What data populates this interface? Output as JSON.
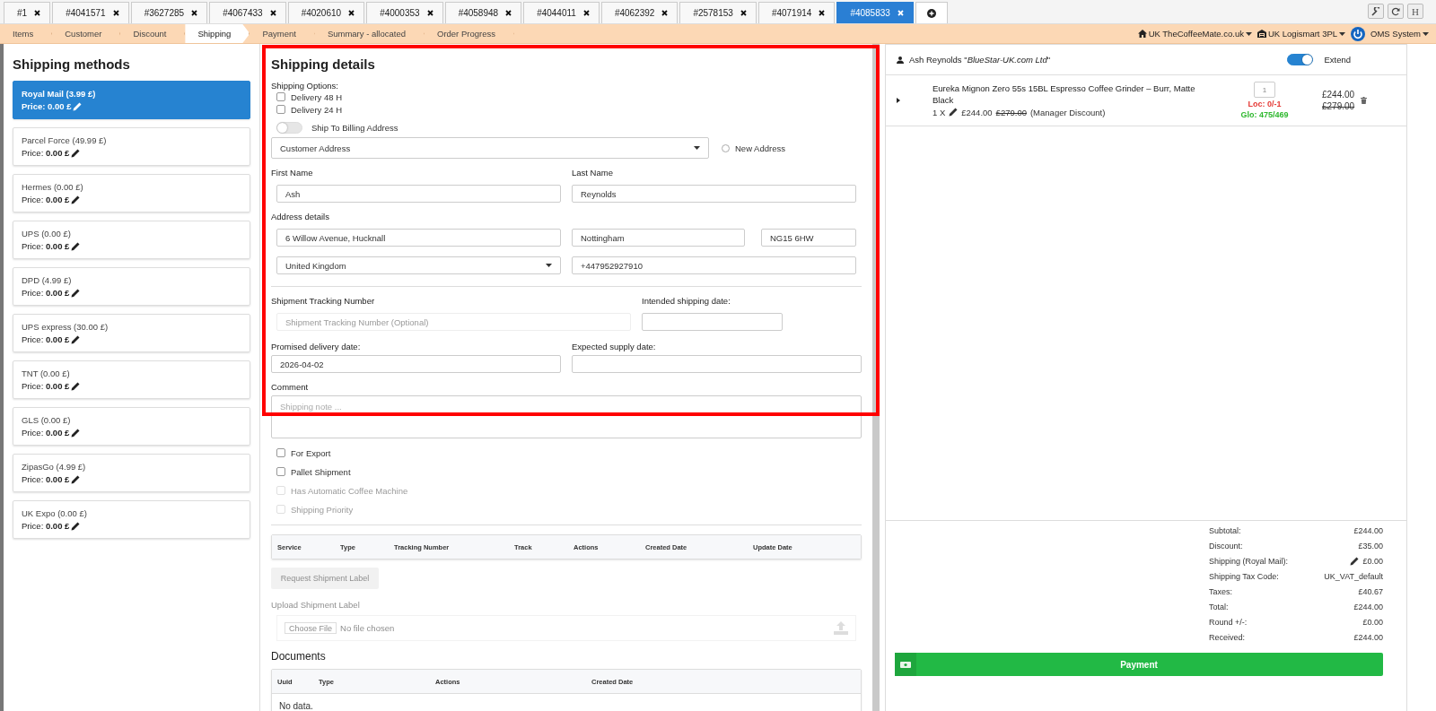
{
  "tabs": [
    {
      "label": "#1",
      "selected": false
    },
    {
      "label": "#4041571",
      "selected": false
    },
    {
      "label": "#3627285",
      "selected": false
    },
    {
      "label": "#4067433",
      "selected": false
    },
    {
      "label": "#4020610",
      "selected": false
    },
    {
      "label": "#4000353",
      "selected": false
    },
    {
      "label": "#4058948",
      "selected": false
    },
    {
      "label": "#4044011",
      "selected": false
    },
    {
      "label": "#4062392",
      "selected": false
    },
    {
      "label": "#2578153",
      "selected": false
    },
    {
      "label": "#4071914",
      "selected": false
    },
    {
      "label": "#4085833",
      "selected": true
    }
  ],
  "tool_buttons": [
    {
      "kind": "wrench"
    },
    {
      "kind": "refresh"
    },
    {
      "kind": "text",
      "label": "H"
    }
  ],
  "steps": [
    {
      "label": "Items",
      "selected": false
    },
    {
      "label": "Customer",
      "selected": false
    },
    {
      "label": "Discount",
      "selected": false
    },
    {
      "label": "Shipping",
      "selected": true
    },
    {
      "label": "Payment",
      "selected": false
    },
    {
      "label": "Summary - allocated",
      "selected": false
    },
    {
      "label": "Order Progress",
      "selected": false
    }
  ],
  "header_menus": [
    {
      "kind": "home",
      "label": "UK TheCoffeeMate.co.uk"
    },
    {
      "kind": "building",
      "label": "UK Logismart 3PL"
    },
    {
      "kind": "power"
    },
    {
      "kind": "plain",
      "label": "OMS System"
    }
  ],
  "shipping_methods": {
    "title": "Shipping methods",
    "items": [
      {
        "name": "Royal Mail (3.99 £)",
        "price": "Price: **0.00 £**",
        "selected": true
      },
      {
        "name": "Parcel Force (49.99 £)",
        "price": "Price: **0.00 £**",
        "selected": false
      },
      {
        "name": "Hermes (0.00 £)",
        "price": "Price: **0.00 £**",
        "selected": false
      },
      {
        "name": "UPS (0.00 £)",
        "price": "Price: **0.00 £**",
        "selected": false
      },
      {
        "name": "DPD (4.99 £)",
        "price": "Price: **0.00 £**",
        "selected": false
      },
      {
        "name": "UPS express (30.00 £)",
        "price": "Price: **0.00 £**",
        "selected": false
      },
      {
        "name": "TNT (0.00 £)",
        "price": "Price: **0.00 £**",
        "selected": false
      },
      {
        "name": "GLS (0.00 £)",
        "price": "Price: **0.00 £**",
        "selected": false
      },
      {
        "name": "ZipasGo (4.99 £)",
        "price": "Price: **0.00 £**",
        "selected": false
      },
      {
        "name": "UK Expo (0.00 £)",
        "price": "Price: **0.00 £**",
        "selected": false
      }
    ]
  },
  "shipping_details": {
    "title": "Shipping details",
    "options_label": "Shipping Options:",
    "options": [
      {
        "label": "Delivery 48 H",
        "checked": false
      },
      {
        "label": "Delivery 24 H",
        "checked": false
      }
    ],
    "ship_to_billing": {
      "label": "Ship To Billing Address",
      "on": false
    },
    "address_select": {
      "value": "Customer Address"
    },
    "new_address": {
      "label": "New Address",
      "selected": false
    },
    "first_name": {
      "label": "First Name",
      "value": "Ash"
    },
    "last_name": {
      "label": "Last Name",
      "value": "Reynolds"
    },
    "address_label": "Address details",
    "street": {
      "value": "6 Willow Avenue, Hucknall"
    },
    "city": {
      "value": "Nottingham"
    },
    "postcode": {
      "value": "NG15 6HW"
    },
    "country": {
      "value": "United Kingdom"
    },
    "phone": {
      "value": "+447952927910"
    },
    "tracking": {
      "label": "Shipment Tracking Number",
      "placeholder": "Shipment Tracking Number (Optional)",
      "disabled": true
    },
    "intended_date": {
      "label": "Intended shipping date:"
    },
    "promised_date": {
      "label": "Promised delivery date:",
      "value": "2026-04-02"
    },
    "supply_date": {
      "label": "Expected supply date:"
    },
    "comment": {
      "label": "Comment",
      "placeholder": "Shipping note ..."
    },
    "flags": [
      {
        "label": "For Export",
        "checked": false,
        "disabled": false
      },
      {
        "label": "Pallet Shipment",
        "checked": false,
        "disabled": false
      },
      {
        "label": "Has Automatic Coffee Machine",
        "checked": false,
        "disabled": true
      },
      {
        "label": "Shipping Priority",
        "checked": false,
        "disabled": true
      }
    ],
    "shipments_table": {
      "columns": [
        "Service",
        "Type",
        "Tracking Number",
        "Track",
        "Actions",
        "Created Date",
        "Update Date"
      ]
    },
    "request_button": {
      "label": "Request Shipment Label",
      "disabled": true
    },
    "upload": {
      "label": "Upload Shipment Label",
      "button": "Choose File",
      "status": "No file chosen"
    },
    "documents": {
      "title": "Documents",
      "columns": [
        "Uuid",
        "Type",
        "Actions",
        "Created Date"
      ],
      "empty": "No data."
    }
  },
  "order": {
    "customer": "Ash Reynolds \"*BlueStar-UK.com Ltd*\"",
    "extend": {
      "label": "Extend",
      "on": true
    },
    "lines": [
      {
        "name": "Eureka Mignon Zero 55s 15BL Espresso Coffee Grinder – Burr, Matte Black",
        "qty": "1 X",
        "price": "£244.00",
        "old_price": "£279.00",
        "note": "(Manager Discount)",
        "quantity": "1",
        "stock": [
          {
            "text": "Loc: 0/-1",
            "color": "#e53935"
          },
          {
            "text": "Glo: 475/469",
            "color": "#2eb82e"
          }
        ],
        "total": "£244.00",
        "old_total": "£279.00"
      }
    ],
    "summary": [
      {
        "label": "Subtotal:",
        "value": "£244.00",
        "editable": false
      },
      {
        "label": "Discount:",
        "value": "£35.00",
        "editable": false
      },
      {
        "label": "Shipping (Royal Mail):",
        "value": "£0.00",
        "editable": true
      },
      {
        "label": "Shipping Tax Code:",
        "value": "UK_VAT_default",
        "editable": false
      },
      {
        "label": "Taxes:",
        "value": "£40.67",
        "editable": false
      },
      {
        "label": "Total:",
        "value": "£244.00",
        "editable": false
      },
      {
        "label": "Round +/-:",
        "value": "£0.00",
        "editable": false
      },
      {
        "label": "Received:",
        "value": "£244.00",
        "editable": false
      }
    ],
    "payment_button": "Payment"
  }
}
